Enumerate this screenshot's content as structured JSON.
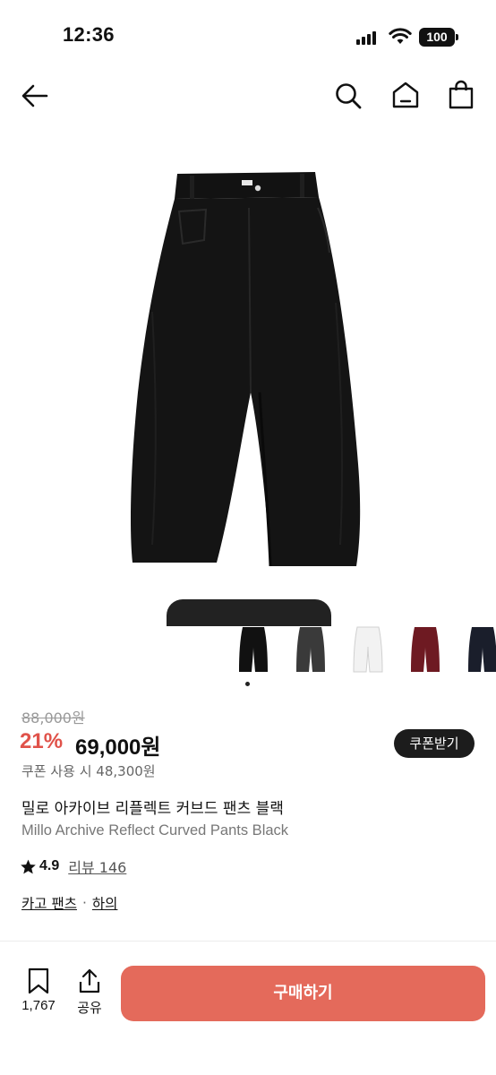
{
  "status_bar": {
    "time": "12:36",
    "battery": "100"
  },
  "nav": {
    "back_icon": "back-arrow-icon",
    "search_icon": "search-icon",
    "home_icon": "home-icon",
    "bag_icon": "shopping-bag-icon"
  },
  "product": {
    "thumbnails": [
      {
        "name": "black",
        "color": "#111111"
      },
      {
        "name": "charcoal",
        "color": "#3a3a3a"
      },
      {
        "name": "white",
        "color": "#f2f2f2"
      },
      {
        "name": "burgundy",
        "color": "#6e1a22"
      },
      {
        "name": "navy",
        "color": "#1a1e2b"
      }
    ],
    "selected_thumbnail": 0,
    "original_price": "88,000원",
    "discount_rate": "21%",
    "sale_price": "69,000원",
    "coupon_button": "쿠폰받기",
    "coupon_price": "쿠폰 사용 시 48,300원",
    "title_ko": "밀로 아카이브 리플렉트 커브드 팬츠 블랙",
    "title_en": "Millo Archive Reflect Curved Pants Black",
    "rating": "4.9",
    "review_label": "리뷰 146",
    "category": "카고 팬츠",
    "category_sep": "·",
    "subcategory": "하의"
  },
  "bottom_bar": {
    "wish_count": "1,767",
    "share_label": "공유",
    "buy_label": "구매하기"
  },
  "colors": {
    "accent": "#e46a5b",
    "discount": "#e0524a",
    "dark": "#1c1c1c"
  }
}
